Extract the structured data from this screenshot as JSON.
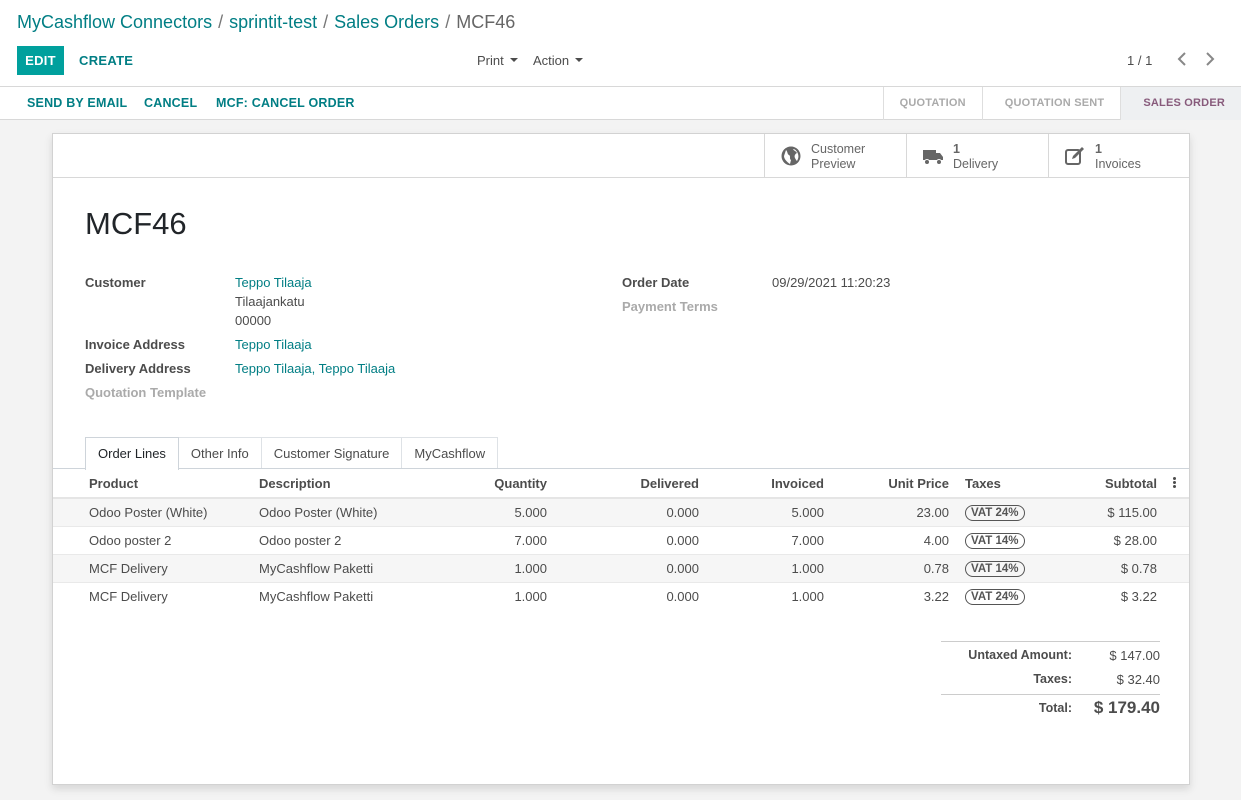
{
  "breadcrumb": {
    "items": [
      "MyCashflow Connectors",
      "sprintit-test",
      "Sales Orders"
    ],
    "current": "MCF46",
    "separator": "/"
  },
  "toolbar": {
    "edit_label": "EDIT",
    "create_label": "CREATE",
    "print_label": "Print",
    "action_label": "Action",
    "pager_value": "1 / 1"
  },
  "statusbar": {
    "send_email": "SEND BY EMAIL",
    "cancel": "CANCEL",
    "mcf_cancel": "MCF: CANCEL ORDER",
    "stages": [
      "QUOTATION",
      "QUOTATION SENT",
      "SALES ORDER"
    ],
    "active_stage": "SALES ORDER"
  },
  "smart_buttons": {
    "preview": {
      "line1": "Customer",
      "line2": "Preview",
      "icon": "globe-icon"
    },
    "delivery": {
      "count": "1",
      "label": "Delivery",
      "icon": "truck-icon"
    },
    "invoices": {
      "count": "1",
      "label": "Invoices",
      "icon": "pencil-square-icon"
    }
  },
  "record": {
    "name": "MCF46",
    "labels": {
      "customer": "Customer",
      "invoice_address": "Invoice Address",
      "delivery_address": "Delivery Address",
      "quotation_template": "Quotation Template",
      "order_date": "Order Date",
      "payment_terms": "Payment Terms"
    },
    "customer": "Teppo Tilaaja",
    "customer_street": "Tilaajankatu",
    "customer_zip": "00000",
    "invoice_address": "Teppo Tilaaja",
    "delivery_address": "Teppo Tilaaja, Teppo Tilaaja",
    "order_date": "09/29/2021 11:20:23"
  },
  "tabs": [
    "Order Lines",
    "Other Info",
    "Customer Signature",
    "MyCashflow"
  ],
  "order_lines": {
    "columns": [
      "Product",
      "Description",
      "Quantity",
      "Delivered",
      "Invoiced",
      "Unit Price",
      "Taxes",
      "Subtotal"
    ],
    "rows": [
      {
        "product": "Odoo Poster (White)",
        "description": "Odoo Poster (White)",
        "quantity": "5.000",
        "delivered": "0.000",
        "invoiced": "5.000",
        "unit_price": "23.00",
        "tax": "VAT 24%",
        "subtotal": "$ 115.00"
      },
      {
        "product": "Odoo poster 2",
        "description": "Odoo poster 2",
        "quantity": "7.000",
        "delivered": "0.000",
        "invoiced": "7.000",
        "unit_price": "4.00",
        "tax": "VAT 14%",
        "subtotal": "$ 28.00"
      },
      {
        "product": "MCF Delivery",
        "description": "MyCashflow Paketti",
        "quantity": "1.000",
        "delivered": "0.000",
        "invoiced": "1.000",
        "unit_price": "0.78",
        "tax": "VAT 14%",
        "subtotal": "$ 0.78"
      },
      {
        "product": "MCF Delivery",
        "description": "MyCashflow Paketti",
        "quantity": "1.000",
        "delivered": "0.000",
        "invoiced": "1.000",
        "unit_price": "3.22",
        "tax": "VAT 24%",
        "subtotal": "$ 3.22"
      }
    ]
  },
  "totals": {
    "untaxed_label": "Untaxed Amount:",
    "untaxed_value": "$ 147.00",
    "taxes_label": "Taxes:",
    "taxes_value": "$ 32.40",
    "total_label": "Total:",
    "total_value": "$ 179.40"
  },
  "colors": {
    "primary": "#00a09d",
    "link": "#017e84",
    "stage_active": "#875a7b"
  }
}
